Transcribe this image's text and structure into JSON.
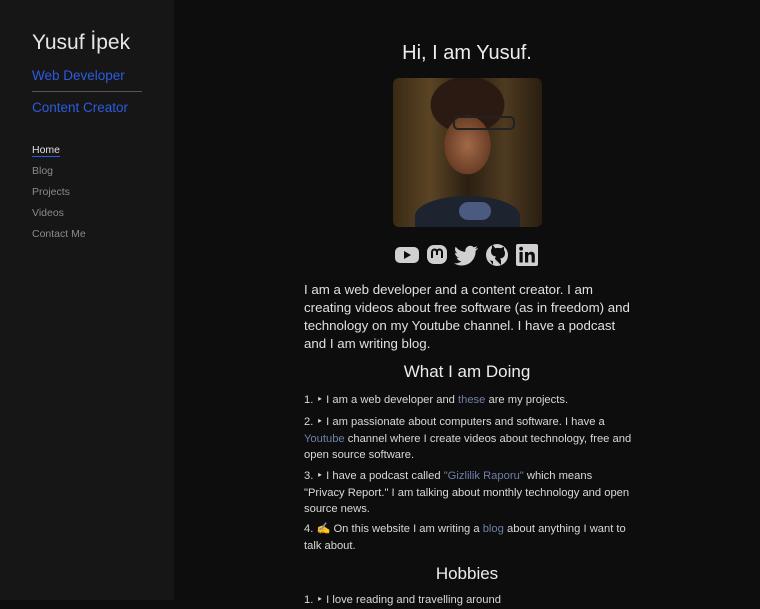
{
  "sidebar": {
    "name": "Yusuf İpek",
    "roles": [
      "Web Developer",
      "Content Creator"
    ],
    "nav": [
      "Home",
      "Blog",
      "Projects",
      "Videos",
      "Contact Me"
    ]
  },
  "main": {
    "greeting": "Hi, I am Yusuf.",
    "social": [
      "youtube-icon",
      "mastodon-icon",
      "twitter-icon",
      "github-icon",
      "linkedin-icon"
    ],
    "intro": "I am a web developer and a content creator. I am creating videos about free software (as in freedom) and technology on my Youtube channel. I have a podcast and I am writing blog.",
    "doing_title": "What I am Doing",
    "doing": {
      "i1": {
        "pre": "1. ‣ I am a web developer and ",
        "link": "these",
        "post": " are my projects."
      },
      "i2": {
        "pre": "2. ‣ I am passionate about computers and software. I have a ",
        "link": "Youtube",
        "post": " channel where I create videos about technology, free and open source software."
      },
      "i3": {
        "pre": "3. ‣ I have a podcast called ",
        "link": "\"Gizlilik Raporu\"",
        "post": " which means \"Privacy Report.\" I am talking about monthly technology and open source news."
      },
      "i4": {
        "pre": "4. ✍ On this website I am writing a ",
        "link": "blog",
        "post": " about anything I want to talk about."
      }
    },
    "hobbies_title": "Hobbies",
    "hobby1": "1. ‣ I love reading and travelling around"
  },
  "colors": {
    "background": "#0d0d0d",
    "sidebar": "#161616",
    "accent": "#2d5be0",
    "link": "#6f7fa8"
  }
}
